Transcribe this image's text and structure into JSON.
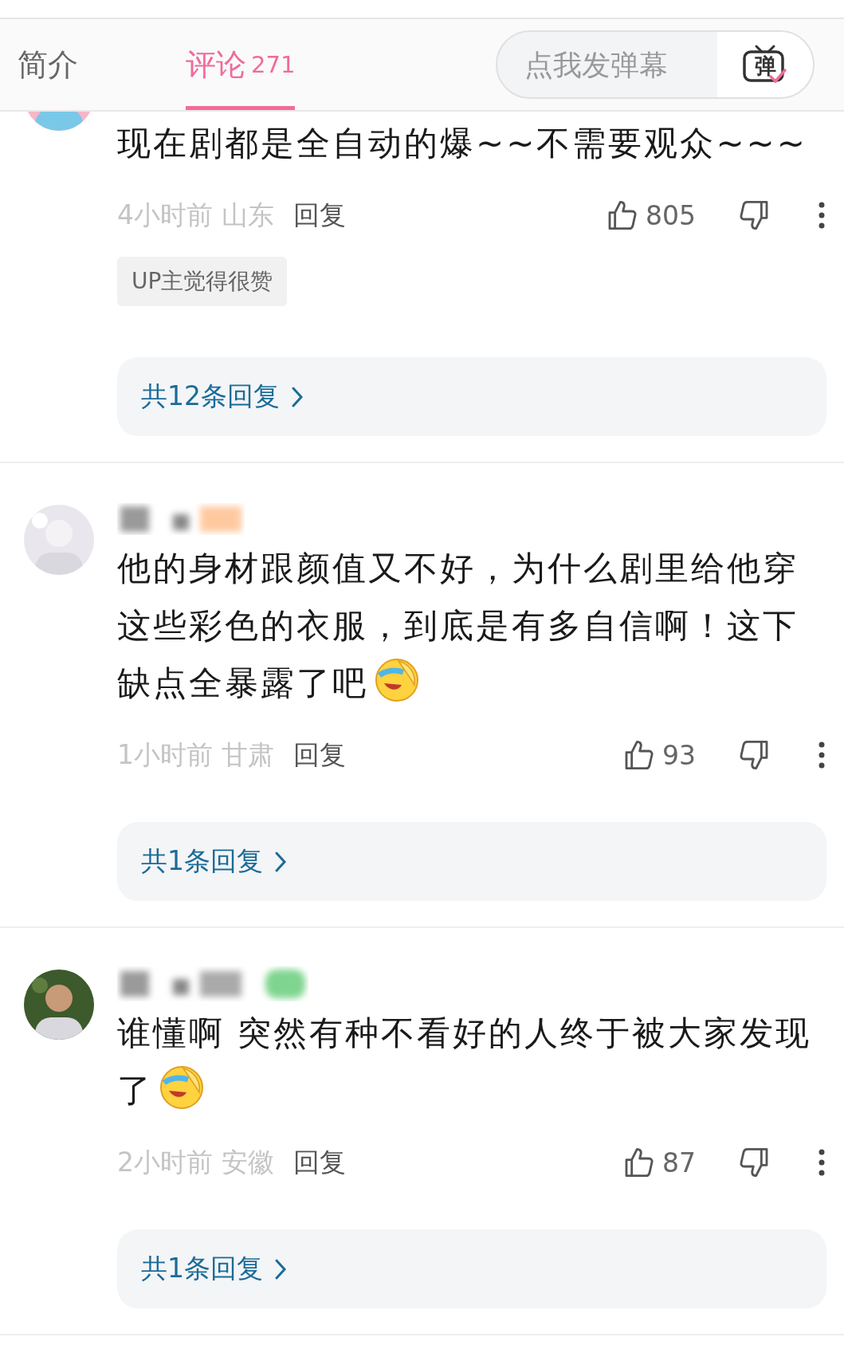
{
  "tabs": [
    {
      "label": "简介",
      "selected": false
    },
    {
      "label": "评论",
      "count": "271",
      "selected": true
    }
  ],
  "danmaku": {
    "placeholder": "点我发弹幕",
    "toggle_label": "弹",
    "toggle_on": true
  },
  "comments": [
    {
      "avatar_clipped": true,
      "text": "现在剧都是全自动的爆~~不需要观众~~~",
      "emoji": false,
      "time": "4小时前",
      "location": "山东",
      "reply": "回复",
      "likes": "805",
      "badge": "UP主觉得很赞",
      "replies": "共12条回复"
    },
    {
      "avatar_clipped": false,
      "username": {
        "kind": "blurred"
      },
      "text": "他的身材跟颜值又不好，为什么剧里给他穿这些彩色的衣服，到底是有多自信啊！这下缺点全暴露了吧",
      "emoji": true,
      "time": "1小时前",
      "location": "甘肃",
      "reply": "回复",
      "likes": "93",
      "replies": "共1条回复"
    },
    {
      "avatar_clipped": false,
      "username": {
        "kind": "blurred"
      },
      "text": "谁懂啊 突然有种不看好的人终于被大家发现了",
      "emoji": true,
      "time": "2小时前",
      "location": "安徽",
      "reply": "回复",
      "likes": "87",
      "replies": "共1条回复"
    }
  ]
}
